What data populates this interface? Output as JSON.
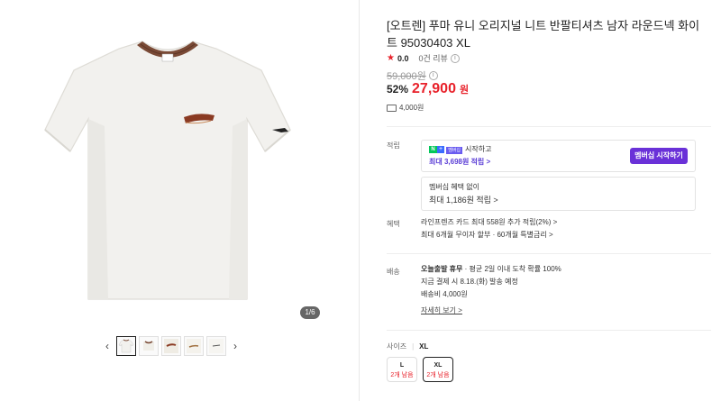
{
  "gallery": {
    "page_indicator": "1/6",
    "prev_icon": "chevron-left-icon",
    "next_icon": "chevron-right-icon",
    "thumbnail_count": 5
  },
  "product": {
    "title": "[오트렌] 푸마 유니 오리지널 니트 반팔티셔츠 남자 라운드넥 화이트 95030403 XL",
    "rating": "0.0",
    "reviews": "0건 리뷰",
    "original_price": "59,000원",
    "discount": "52%",
    "sale_price": "27,900",
    "currency": "원",
    "shipping_fee": "4,000원"
  },
  "points": {
    "label": "적립",
    "naver_membership_badge": "멤버십",
    "start_text": "시작하고",
    "max_point": "최대 3,698원 적립 >",
    "start_button": "멤버십 시작하기",
    "no_benefit": "멤버십 혜택 없이",
    "max_point_basic": "최대 1,186원 적립 >"
  },
  "benefit": {
    "label": "혜택",
    "line1": "라인프렌즈 카드 최대 558원 추가 적립(2%) >",
    "line2": "최대 6개월 무이자 할부 · 60개월 특별금리 >"
  },
  "delivery": {
    "label": "배송",
    "line1_bold": "오늘출발 휴무",
    "line1_rest": " · 평균 2일 이내 도착 확률 100%",
    "line2": "지금 결제 시 8.18.(화) 발송 예정",
    "line3": "배송비 4,000원",
    "details_link": "자세히 보기 >"
  },
  "size": {
    "label": "사이즈",
    "selected": "XL",
    "options": [
      {
        "name": "L",
        "stock": "2개 남음"
      },
      {
        "name": "XL",
        "stock": "2개 남음"
      }
    ]
  },
  "colors": {
    "accent_red": "#e8212a",
    "membership_purple": "#6a31d8",
    "naver_green": "#03c75a"
  }
}
